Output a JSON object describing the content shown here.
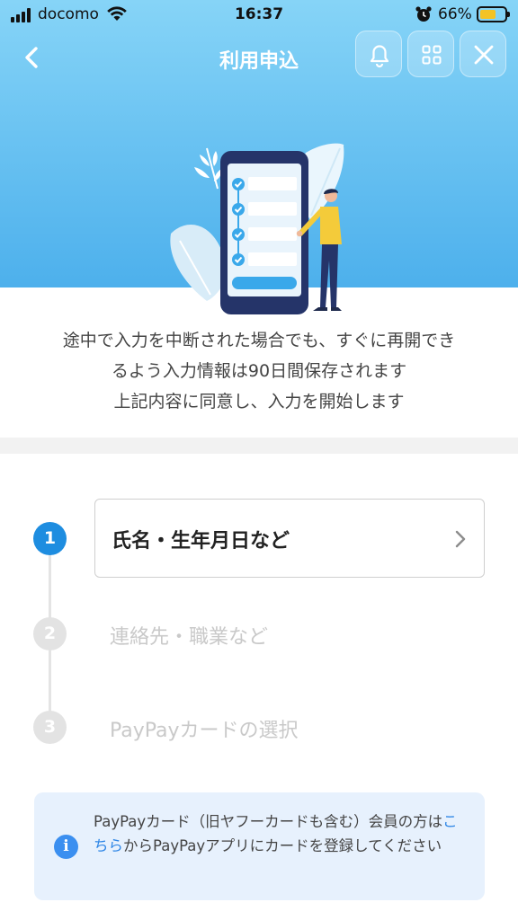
{
  "status_bar": {
    "carrier": "docomo",
    "time": "16:37",
    "battery_percent": "66%",
    "battery_level": 0.66,
    "battery_color": "#f3c325"
  },
  "header": {
    "title": "利用申込",
    "back_icon": "chevron-left-icon",
    "buttons": [
      "bell-icon",
      "grid-icon",
      "close-icon"
    ]
  },
  "notice_lines": [
    "途中で入力を中断された場合でも、すぐに再開でき",
    "るよう入力情報は90日間保存されます",
    "上記内容に同意し、入力を開始します"
  ],
  "steps": [
    {
      "number": "1",
      "label": "氏名・生年月日など",
      "state": "active"
    },
    {
      "number": "2",
      "label": "連絡先・職業など",
      "state": "inactive"
    },
    {
      "number": "3",
      "label": "PayPayカードの選択",
      "state": "inactive"
    }
  ],
  "info": {
    "icon": "info-icon",
    "text_before": "PayPayカード（旧ヤフーカードも含む）会員の方は",
    "link_text": "こちら",
    "text_after": "からPayPayアプリにカードを登録してください"
  },
  "colors": {
    "accent": "#1e8de0",
    "hero_top": "#86d4f7",
    "hero_bottom": "#4db0ec",
    "info_bg": "#e7f1fd",
    "link": "#2e86e6"
  }
}
